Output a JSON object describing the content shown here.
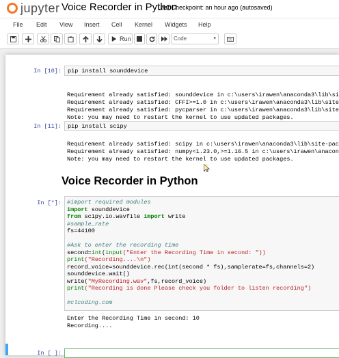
{
  "header": {
    "logo_text": "jupyter",
    "notebook_title": "Voice Recorder in Python",
    "checkpoint": "Last Checkpoint: an hour ago  (autosaved)",
    "brand_color": "#f37726"
  },
  "menu": [
    "File",
    "Edit",
    "View",
    "Insert",
    "Cell",
    "Kernel",
    "Widgets",
    "Help"
  ],
  "toolbar": {
    "run_label": "Run",
    "cell_type": "Code",
    "icons": [
      "save-icon",
      "add-cell-icon",
      "cut-icon",
      "copy-icon",
      "paste-icon",
      "move-up-icon",
      "move-down-icon",
      "run-icon",
      "stop-icon",
      "restart-icon",
      "fast-forward-icon",
      "keyboard-icon"
    ]
  },
  "cells": {
    "c1": {
      "prompt": "In [10]:",
      "input": "pip install sounddevice",
      "output": "Requirement already satisfied: sounddevice in c:\\users\\irawen\\anaconda3\\lib\\site-packages\nRequirement already satisfied: CFFI>=1.0 in c:\\users\\irawen\\anaconda3\\lib\\site-packages\nRequirement already satisfied: pycparser in c:\\users\\irawen\\anaconda3\\lib\\site-packages\nNote: you may need to restart the kernel to use updated packages."
    },
    "c2": {
      "prompt": "In [11]:",
      "input": "pip install scipy",
      "output": "Requirement already satisfied: scipy in c:\\users\\irawen\\anaconda3\\lib\\site-packages\nRequirement already satisfied: numpy<1.23.0,>=1.16.5 in c:\\users\\irawen\\anaconda3\\lib\nNote: you may need to restart the kernel to use updated packages."
    },
    "heading": "Voice Recorder in Python",
    "c3": {
      "prompt": "In [*]:",
      "code": {
        "l1": "#import required modules",
        "l2_kw": "import",
        "l2": " sounddevice",
        "l3_kw1": "from",
        "l3_mid": " scipy.io.wavfile ",
        "l3_kw2": "import",
        "l3_end": " write",
        "l4": "#sample_rate",
        "l5": "fs=44100",
        "l6": "#Ask to enter the recording time",
        "l7a": "second=",
        "l7b": "int",
        "l7c": "(",
        "l7d": "input",
        "l7e": "(\"Enter the Recording Time in second: \"))",
        "l8a": "print",
        "l8b": "(\"Recording....\\n\")",
        "l9": "record_voice=sounddevice.rec(int(second * fs),samplerate=fs,channels=2)",
        "l10": "sounddevice.wait()",
        "l11a": "write(",
        "l11b": "\"MyRecording.wav\"",
        "l11c": ",fs,record_voice)",
        "l12a": "print",
        "l12b": "(\"Recording is done Please check you folder to listen recording\")",
        "l13": "#clcoding.com"
      },
      "output": "Enter the Recording Time in second: 10\nRecording...."
    },
    "c4": {
      "prompt": "In [ ]:"
    }
  }
}
